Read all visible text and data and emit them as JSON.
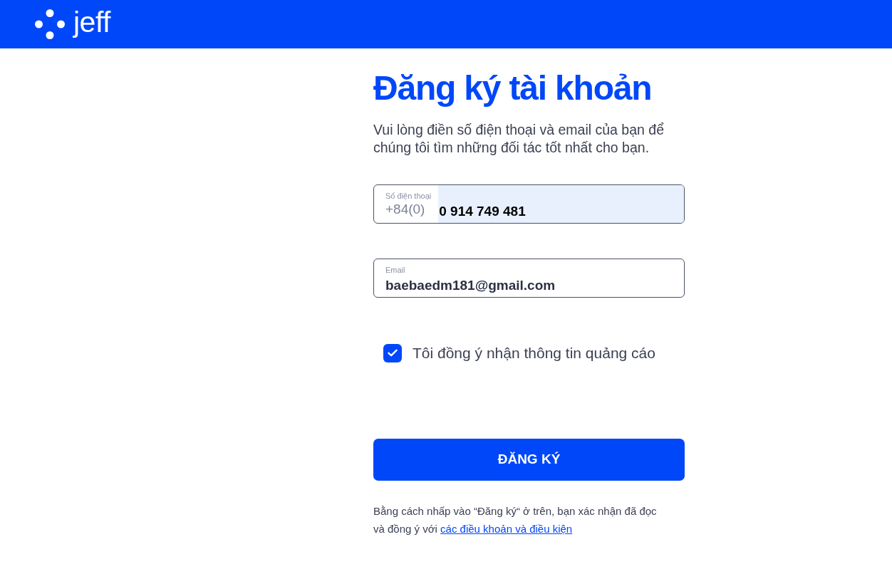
{
  "header": {
    "logo_text": "jeff"
  },
  "title": "Đăng ký tài khoản",
  "subtitle": "Vui lòng điền số điện thoại và email của bạn để chúng tôi tìm những đối tác tốt nhất cho bạn.",
  "fields": [
    {
      "kind": "phone",
      "label": "Số điện thoại",
      "prefix": "+84(0)",
      "value": "0 914 749 481",
      "autofilled": true
    },
    {
      "kind": "email",
      "label": "Email",
      "value": "baebaedm181@gmail.com",
      "autofilled": false
    }
  ],
  "consent": {
    "label": "Tôi đồng ý nhận thông tin quảng cáo",
    "checked": true
  },
  "submit_button": "ĐĂNG KÝ",
  "terms": {
    "text": "Bằng cách nhấp vào “Đăng ký“ ở trên, bạn xác nhận đã đọc và đồng ý với",
    "link": "các điều khoản và điều kiện"
  }
}
